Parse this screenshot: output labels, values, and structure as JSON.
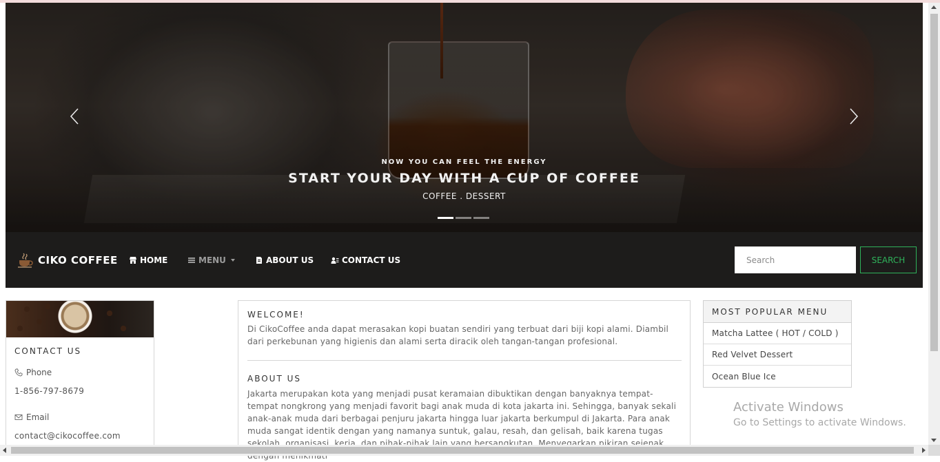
{
  "hero": {
    "kicker": "NOW YOU CAN FEEL THE ENERGY",
    "headline": "START YOUR DAY WITH A CUP OF COFFEE",
    "subline": "COFFEE . DESSERT",
    "prev_icon": "chevron-left-icon",
    "next_icon": "chevron-right-icon",
    "slides": 3,
    "active_slide": 1
  },
  "navbar": {
    "brand": "CIKO COFFEE",
    "brand_icon": "coffee-cup-icon",
    "items": [
      {
        "label": "HOME",
        "icon": "store-icon"
      },
      {
        "label": "MENU",
        "icon": "layers-icon",
        "dropdown": true
      },
      {
        "label": "ABOUT US",
        "icon": "document-icon"
      },
      {
        "label": "CONTACT US",
        "icon": "address-card-icon"
      }
    ],
    "search_placeholder": "Search",
    "search_button": "SEARCH",
    "accent": "#2fb35b"
  },
  "contact": {
    "title": "CONTACT US",
    "phone_label": "Phone",
    "phone": "1-856-797-8679",
    "email_label": "Email",
    "email": "contact@cikocoffee.com"
  },
  "article": {
    "welcome_title": "WELCOME!",
    "welcome_text": "Di CikoCoffee anda dapat merasakan kopi buatan sendiri yang terbuat dari biji kopi alami. Diambil dari perkebunan yang higienis dan alami serta diracik oleh tangan-tangan profesional.",
    "about_title": "ABOUT US",
    "about_text": "Jakarta merupakan kota yang menjadi pusat keramaian dibuktikan dengan banyaknya tempat-tempat nongkrong yang menjadi favorit bagi anak muda di kota jakarta ini. Sehingga, banyak sekali anak-anak muda dari berbagai penjuru jakarta hingga luar jakarta berkumpul di Jakarta. Para anak muda sangat identik dengan yang namanya suntuk, galau, resah, dan gelisah, baik karena tugas sekolah, organisasi, kerja, dan pihak-pihak lain yang bersangkutan. Menyegarkan pikiran sejenak dengan menikmati"
  },
  "popular": {
    "title": "MOST POPULAR MENU",
    "items": [
      "Matcha Lattee ( HOT / COLD )",
      "Red Velvet Dessert",
      "Ocean Blue Ice"
    ]
  },
  "watermark": {
    "title": "Activate Windows",
    "subtitle": "Go to Settings to activate Windows."
  }
}
